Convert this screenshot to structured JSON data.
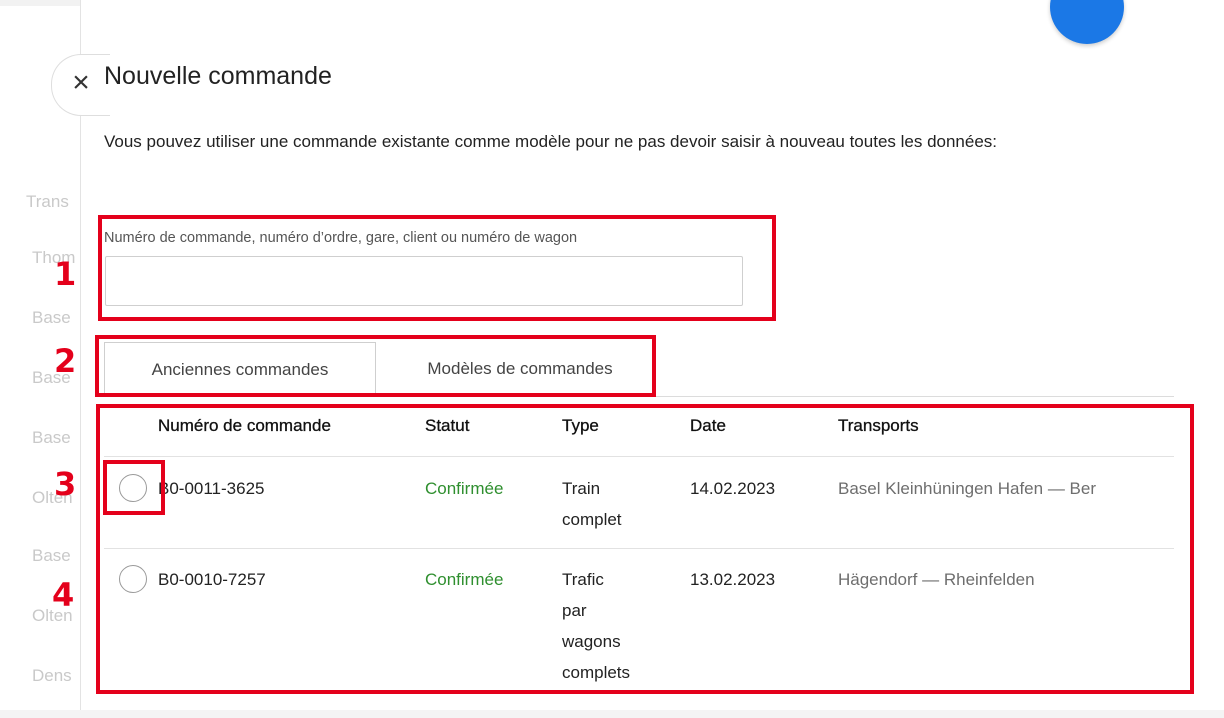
{
  "background": {
    "faded_words": [
      "Trans",
      "Thom",
      "Base",
      "Base",
      "Base",
      "Olten",
      "Base",
      "Olten",
      "Dens"
    ]
  },
  "dialog": {
    "close_icon": "×",
    "title": "Nouvelle commande",
    "intro": "Vous pouvez utiliser une commande existante comme modèle pour ne pas devoir saisir à nouveau toutes les données:",
    "search": {
      "label": "Numéro de commande, numéro d’ordre, gare, client ou numéro de wagon",
      "value": "",
      "placeholder": ""
    },
    "tabs": [
      {
        "label": "Anciennes commandes",
        "active": true
      },
      {
        "label": "Modèles de commandes",
        "active": false
      }
    ],
    "table": {
      "columns": [
        "Numéro de commande",
        "Statut",
        "Type",
        "Date",
        "Transports"
      ],
      "rows": [
        {
          "order_number": "B0-0011-3625",
          "status": "Confirmée",
          "type": "Train complet",
          "date": "14.02.2023",
          "transports": "Basel Kleinhüningen Hafen — Ber"
        },
        {
          "order_number": "B0-0010-7257",
          "status": "Confirmée",
          "type": "Trafic par wagons complets",
          "date": "13.02.2023",
          "transports": "Hägendorf — Rheinfelden"
        }
      ]
    }
  },
  "annotations": {
    "numbers": [
      "1",
      "2",
      "3",
      "4"
    ],
    "color": "#e4001b"
  },
  "colors": {
    "status_confirmed": "#2f8f2f",
    "accent_blue": "#1b78e6"
  }
}
